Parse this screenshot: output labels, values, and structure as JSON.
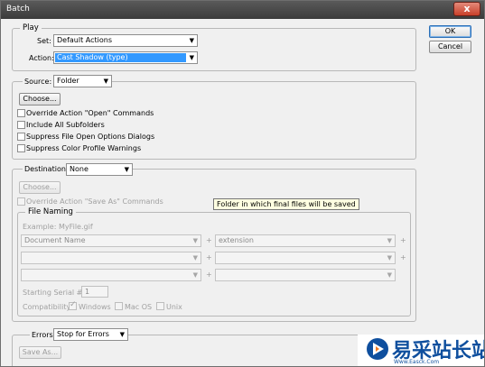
{
  "window": {
    "title": "Batch",
    "close_glyph": "x"
  },
  "buttons": {
    "ok": "OK",
    "cancel": "Cancel"
  },
  "play": {
    "legend": "Play",
    "set_label": "Set:",
    "set_value": "Default Actions",
    "action_label": "Action:",
    "action_value": "Cast Shadow (type)"
  },
  "source": {
    "label": "Source:",
    "value": "Folder",
    "choose": "Choose...",
    "options": [
      "Override Action \"Open\" Commands",
      "Include All Subfolders",
      "Suppress File Open Options Dialogs",
      "Suppress Color Profile Warnings"
    ]
  },
  "destination": {
    "label": "Destination:",
    "value": "None",
    "choose": "Choose...",
    "override_save": "Override Action \"Save As\" Commands",
    "tooltip": "Folder in which final files will be saved",
    "file_naming": {
      "legend": "File Naming",
      "example": "Example: MyFile.gif",
      "row1_left": "Document Name",
      "row1_right": "extension",
      "plus": "+",
      "serial_label": "Starting Serial #:",
      "serial_value": "1",
      "compat_label": "Compatibility:",
      "compat": [
        "Windows",
        "Mac OS",
        "Unix"
      ]
    }
  },
  "errors": {
    "label": "Errors:",
    "value": "Stop for Errors",
    "save_as": "Save As..."
  },
  "watermark": {
    "text": "易采站长站",
    "url": "Www.Easck.Com"
  }
}
